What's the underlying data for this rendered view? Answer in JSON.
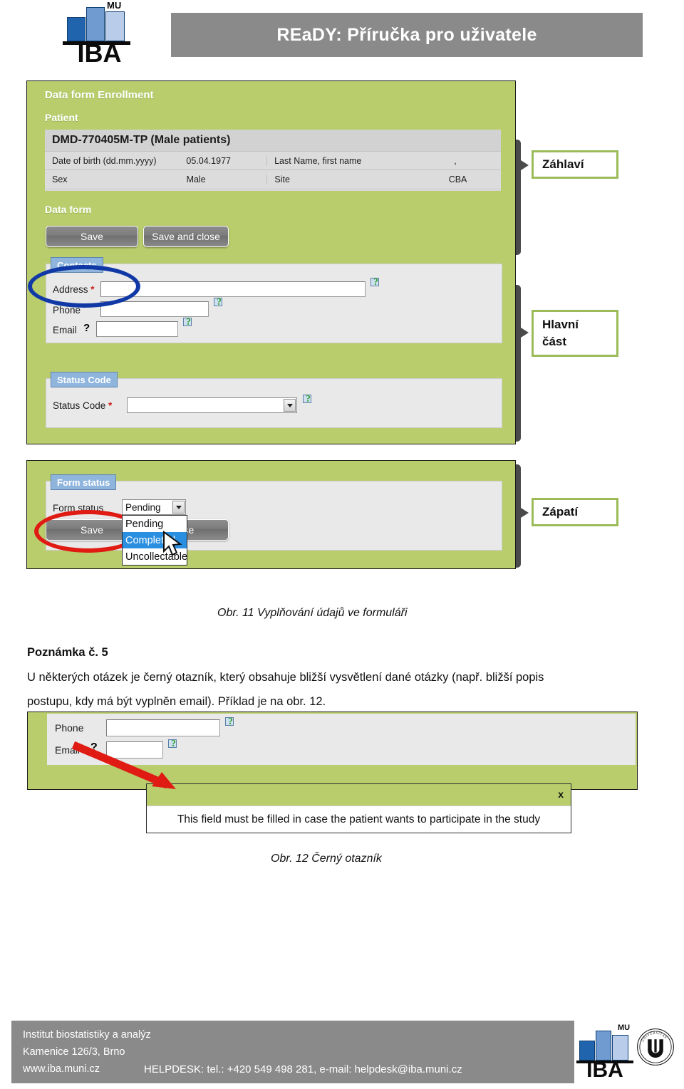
{
  "document": {
    "header_title": "REaDY:   Příručka pro uživatele",
    "logo": {
      "brand": "IBA",
      "superscript": "MU"
    }
  },
  "figure11": {
    "enrollment_title": "Data form Enrollment",
    "patient_section_title": "Patient",
    "patient_code": "DMD-770405M-TP (Male patients)",
    "patient_rows": [
      {
        "label1": "Date of birth (dd.mm.yyyy)",
        "value1": "05.04.1977",
        "label2": "Last Name, first name",
        "value2": ","
      },
      {
        "label1": "Sex",
        "value1": "Male",
        "label2": "Site",
        "value2": "CBA"
      }
    ],
    "data_form_title": "Data form",
    "buttons": {
      "save": "Save",
      "save_and_close": "Save and close"
    },
    "contacts": {
      "tab_label": "Contacts",
      "fields": [
        {
          "label": "Address",
          "required": true,
          "value": ""
        },
        {
          "label": "Phone",
          "required": false,
          "value": ""
        },
        {
          "label": "Email",
          "required": false,
          "value": ""
        }
      ]
    },
    "status_code": {
      "tab_label": "Status Code",
      "field_label": "Status Code",
      "required": true,
      "value": ""
    },
    "form_status": {
      "tab_label": "Form status",
      "field_label": "Form status",
      "selected": "Pending",
      "options": [
        "Pending",
        "Completed",
        "Uncollectable"
      ],
      "highlighted_option": "Completed",
      "save_label": "Save",
      "close_label": "ose"
    },
    "annotations": [
      {
        "label": "Záhlaví"
      },
      {
        "label_line1": "Hlavní",
        "label_line2": "část"
      },
      {
        "label": "Zápatí"
      }
    ],
    "highlight_colors": {
      "blue_ellipse": "#1139a6",
      "red_ellipse": "#e01b14",
      "green_panel": "#b9cd6d"
    },
    "caption": "Obr. 11 Vyplňování údajů ve formuláři"
  },
  "note": {
    "heading": "Poznámka č. 5",
    "line1": "U některých otázek je černý otazník, který obsahuje bližší vysvětlení dané otázky (např. bližší popis",
    "line2": "postupu, kdy má být vyplněn email). Příklad je na obr. 12."
  },
  "figure12": {
    "fields": [
      {
        "label": "Phone",
        "value": ""
      },
      {
        "label": "Email",
        "value": ""
      }
    ],
    "tooltip": {
      "text": "This field must be filled in case the patient wants to participate in the study",
      "close_label": "x"
    },
    "caption": "Obr. 12 Černý otazník"
  },
  "footer": {
    "institute": "Institut biostatistiky a analýz",
    "address": "Kamenice 126/3, Brno",
    "web": "www.iba.muni.cz",
    "helpdesk": "HELPDESK: tel.: +420 549 498 281, e-mail: helpdesk@iba.muni.cz",
    "seal_text": "UNIVERSITAS MASARYKIANA BRUNENSIS"
  }
}
